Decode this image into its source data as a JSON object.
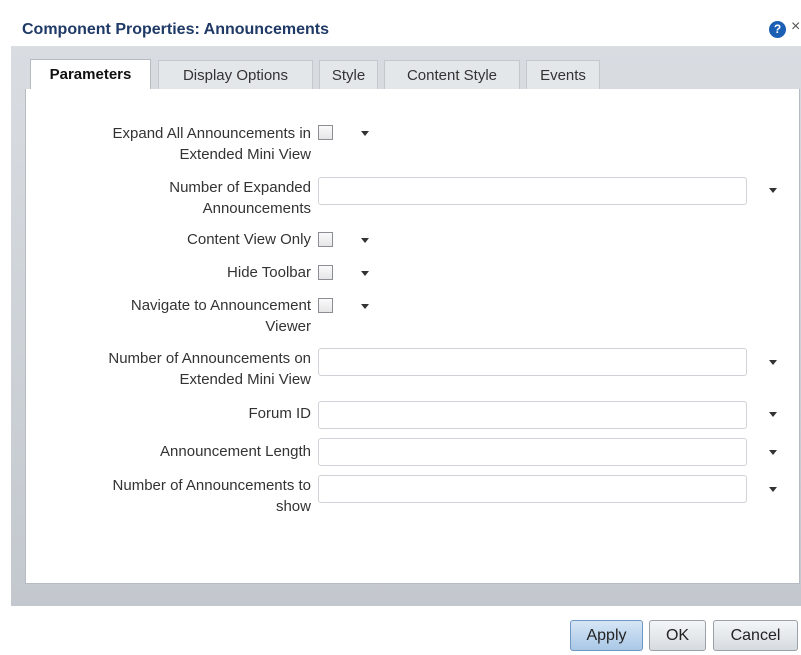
{
  "dialog": {
    "title": "Component Properties: Announcements",
    "help_icon": "?",
    "close_icon": "×"
  },
  "tabs": [
    {
      "label": "Parameters",
      "active": true
    },
    {
      "label": "Display Options",
      "active": false
    },
    {
      "label": "Style",
      "active": false
    },
    {
      "label": "Content Style",
      "active": false
    },
    {
      "label": "Events",
      "active": false
    }
  ],
  "params": [
    {
      "label_lines": [
        "Expand All Announcements in",
        "Extended Mini View"
      ],
      "control": "checkbox",
      "checked": false
    },
    {
      "label_lines": [
        "Number of Expanded",
        "Announcements"
      ],
      "control": "text",
      "value": ""
    },
    {
      "label_lines": [
        "Content View Only"
      ],
      "control": "checkbox",
      "checked": false
    },
    {
      "label_lines": [
        "Hide Toolbar"
      ],
      "control": "checkbox",
      "checked": false
    },
    {
      "label_lines": [
        "Navigate to Announcement",
        "Viewer"
      ],
      "control": "checkbox",
      "checked": false
    },
    {
      "label_lines": [
        "Number of Announcements on",
        "Extended Mini View"
      ],
      "control": "text",
      "value": ""
    },
    {
      "label_lines": [
        "Forum ID"
      ],
      "control": "text",
      "value": ""
    },
    {
      "label_lines": [
        "Announcement Length"
      ],
      "control": "text",
      "value": ""
    },
    {
      "label_lines": [
        "Number of Announcements to",
        "show"
      ],
      "control": "text",
      "value": ""
    }
  ],
  "buttons": {
    "apply": "Apply",
    "ok": "OK",
    "cancel": "Cancel"
  },
  "icons": {
    "help": "help-icon",
    "close": "close-icon",
    "dropdown": "chevron-down-icon"
  },
  "colors": {
    "title": "#1f3a66",
    "help_icon": "#1a5fb4",
    "primary_button": "#a9c7e6"
  }
}
